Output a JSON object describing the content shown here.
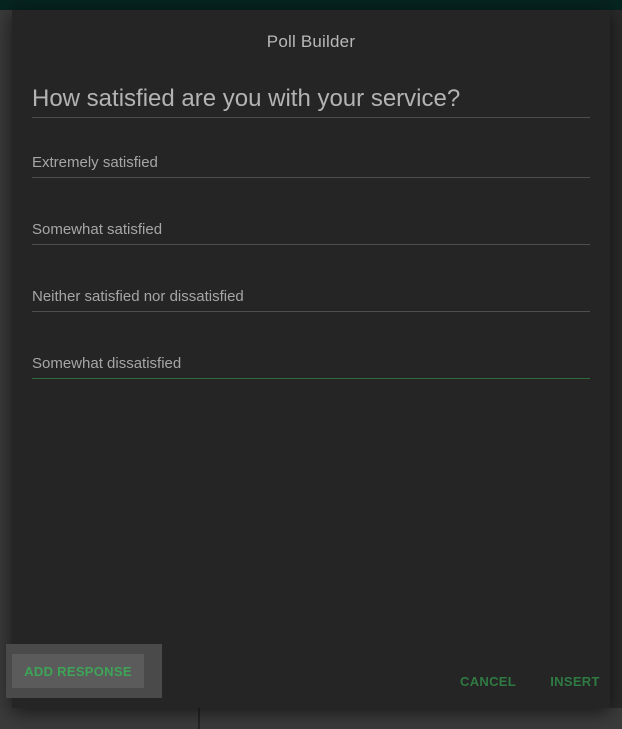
{
  "dialog": {
    "title": "Poll Builder",
    "question": {
      "value": "How satisfied are you with your service?"
    },
    "responses": [
      {
        "value": "Extremely satisfied"
      },
      {
        "value": "Somewhat satisfied"
      },
      {
        "value": "Neither satisfied nor dissatisfied"
      },
      {
        "value": "Somewhat dissatisfied",
        "focused": true
      }
    ]
  },
  "actions": {
    "add_response_label": "ADD RESPONSE",
    "cancel_label": "CANCEL",
    "insert_label": "INSERT"
  },
  "colors": {
    "accent": "#3ea457",
    "dialog_background": "#252525",
    "top_bar": "#062420"
  }
}
